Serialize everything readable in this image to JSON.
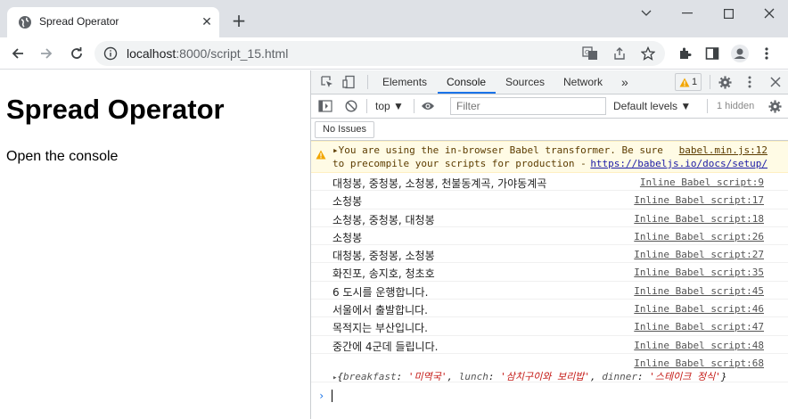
{
  "tab": {
    "title": "Spread Operator",
    "close": "✕",
    "new_tab": "+"
  },
  "window": {
    "minimize": "⌄",
    "restore": "—",
    "maximize": "☐",
    "close": "✕"
  },
  "address": {
    "host": "localhost",
    "path": ":8000/script_15.html"
  },
  "page": {
    "heading": "Spread Operator",
    "text": "Open the console"
  },
  "devtools": {
    "tabs": [
      "Elements",
      "Console",
      "Sources",
      "Network"
    ],
    "more": "»",
    "warning_count": "1",
    "context": "top",
    "filter_placeholder": "Filter",
    "levels": "Default levels",
    "hidden": "1 hidden",
    "issues": "No Issues",
    "warning": {
      "line1": "You are using the in-browser Babel transformer. Be sure",
      "line2": "to precompile your scripts for production - ",
      "source": "babel.min.js:12",
      "link": "https://babeljs.io/docs/setup/"
    },
    "logs": [
      {
        "msg": "대청봉, 중청봉, 소청봉, 천불동계곡, 가야동계곡",
        "src": "Inline Babel script:9"
      },
      {
        "msg": "소청봉",
        "src": "Inline Babel script:17"
      },
      {
        "msg": "소청봉, 중청봉, 대청봉",
        "src": "Inline Babel script:18"
      },
      {
        "msg": "소청봉",
        "src": "Inline Babel script:26"
      },
      {
        "msg": "대청봉, 중청봉, 소청봉",
        "src": "Inline Babel script:27"
      },
      {
        "msg": "화진포, 송지호, 청초호",
        "src": "Inline Babel script:35"
      },
      {
        "msg": "6 도시를 운행합니다.",
        "src": "Inline Babel script:45"
      },
      {
        "msg": "서울에서 출발합니다.",
        "src": "Inline Babel script:46"
      },
      {
        "msg": "목적지는 부산입니다.",
        "src": "Inline Babel script:47"
      },
      {
        "msg": "중간에 4군데 들립니다.",
        "src": "Inline Babel script:48"
      }
    ],
    "object_log": {
      "src": "Inline Babel script:68",
      "k1": "breakfast",
      "v1": "'미역국'",
      "k2": "lunch",
      "v2": "'삼치구이와 보리밥'",
      "k3": "dinner",
      "v3": "'스테이크 정식'"
    },
    "prompt": "›"
  }
}
